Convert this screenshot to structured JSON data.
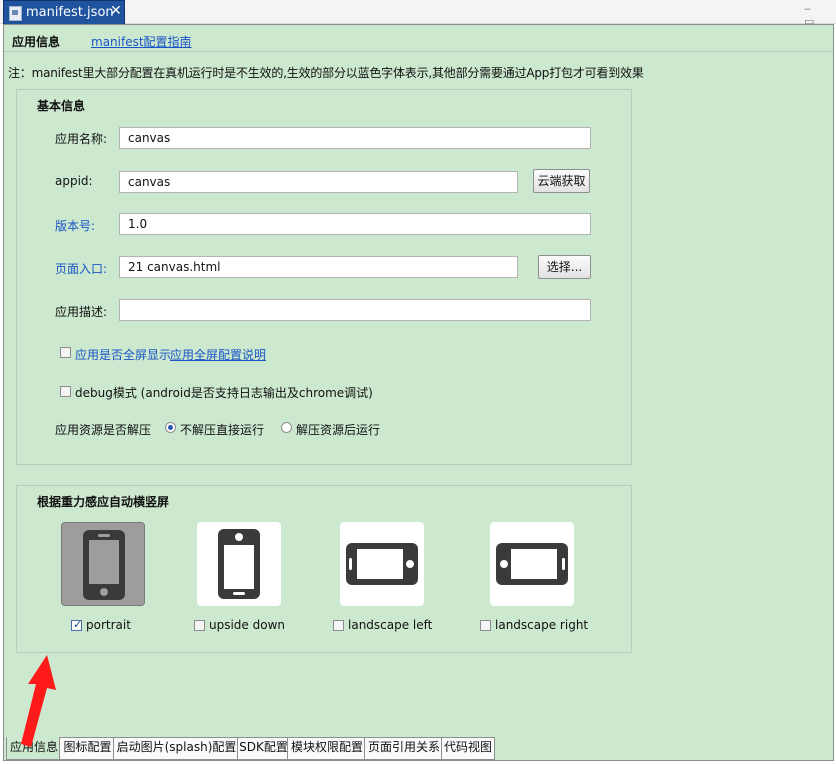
{
  "editor": {
    "tab_title": "manifest.json",
    "tab_close": "✕",
    "window_controls": "‒ ▭"
  },
  "header": {
    "title": "应用信息",
    "guide_link": "manifest配置指南"
  },
  "notice": "注：manifest里大部分配置在真机运行时是不生效的,生效的部分以蓝色字体表示,其他部分需要通过App打包才可看到效果",
  "basic": {
    "title": "基本信息",
    "app_name": {
      "label": "应用名称:",
      "value": "canvas"
    },
    "appid": {
      "label": "appid:",
      "value": "canvas",
      "button": "云端获取"
    },
    "version": {
      "label": "版本号:",
      "value": "1.0"
    },
    "entry": {
      "label": "页面入口:",
      "value": "21 canvas.html",
      "button": "选择..."
    },
    "description": {
      "label": "应用描述:",
      "value": ""
    },
    "fullscreen": {
      "label": "应用是否全屏显示",
      "link": "应用全屏配置说明",
      "checked": false
    },
    "debug": {
      "label": "debug模式 (android是否支持日志输出及chrome调试)",
      "checked": false
    },
    "decompress": {
      "label": "应用资源是否解压",
      "options": [
        "不解压直接运行",
        "解压资源后运行"
      ],
      "selected": "不解压直接运行"
    }
  },
  "orientation": {
    "title": "根据重力感应自动横竖屏",
    "options": [
      {
        "label": "portrait",
        "checked": true
      },
      {
        "label": "upside down",
        "checked": false
      },
      {
        "label": "landscape left",
        "checked": false
      },
      {
        "label": "landscape right",
        "checked": false
      }
    ]
  },
  "bottom_tabs": [
    "应用信息",
    "图标配置",
    "启动图片(splash)配置",
    "SDK配置",
    "模块权限配置",
    "页面引用关系",
    "代码视图"
  ],
  "active_bottom_tab": "应用信息",
  "colors": {
    "panel_bg": "#cce8cf",
    "tab_blue": "#20539d",
    "link_blue": "#1a55c6",
    "annotation_red": "#ff1a1a"
  }
}
